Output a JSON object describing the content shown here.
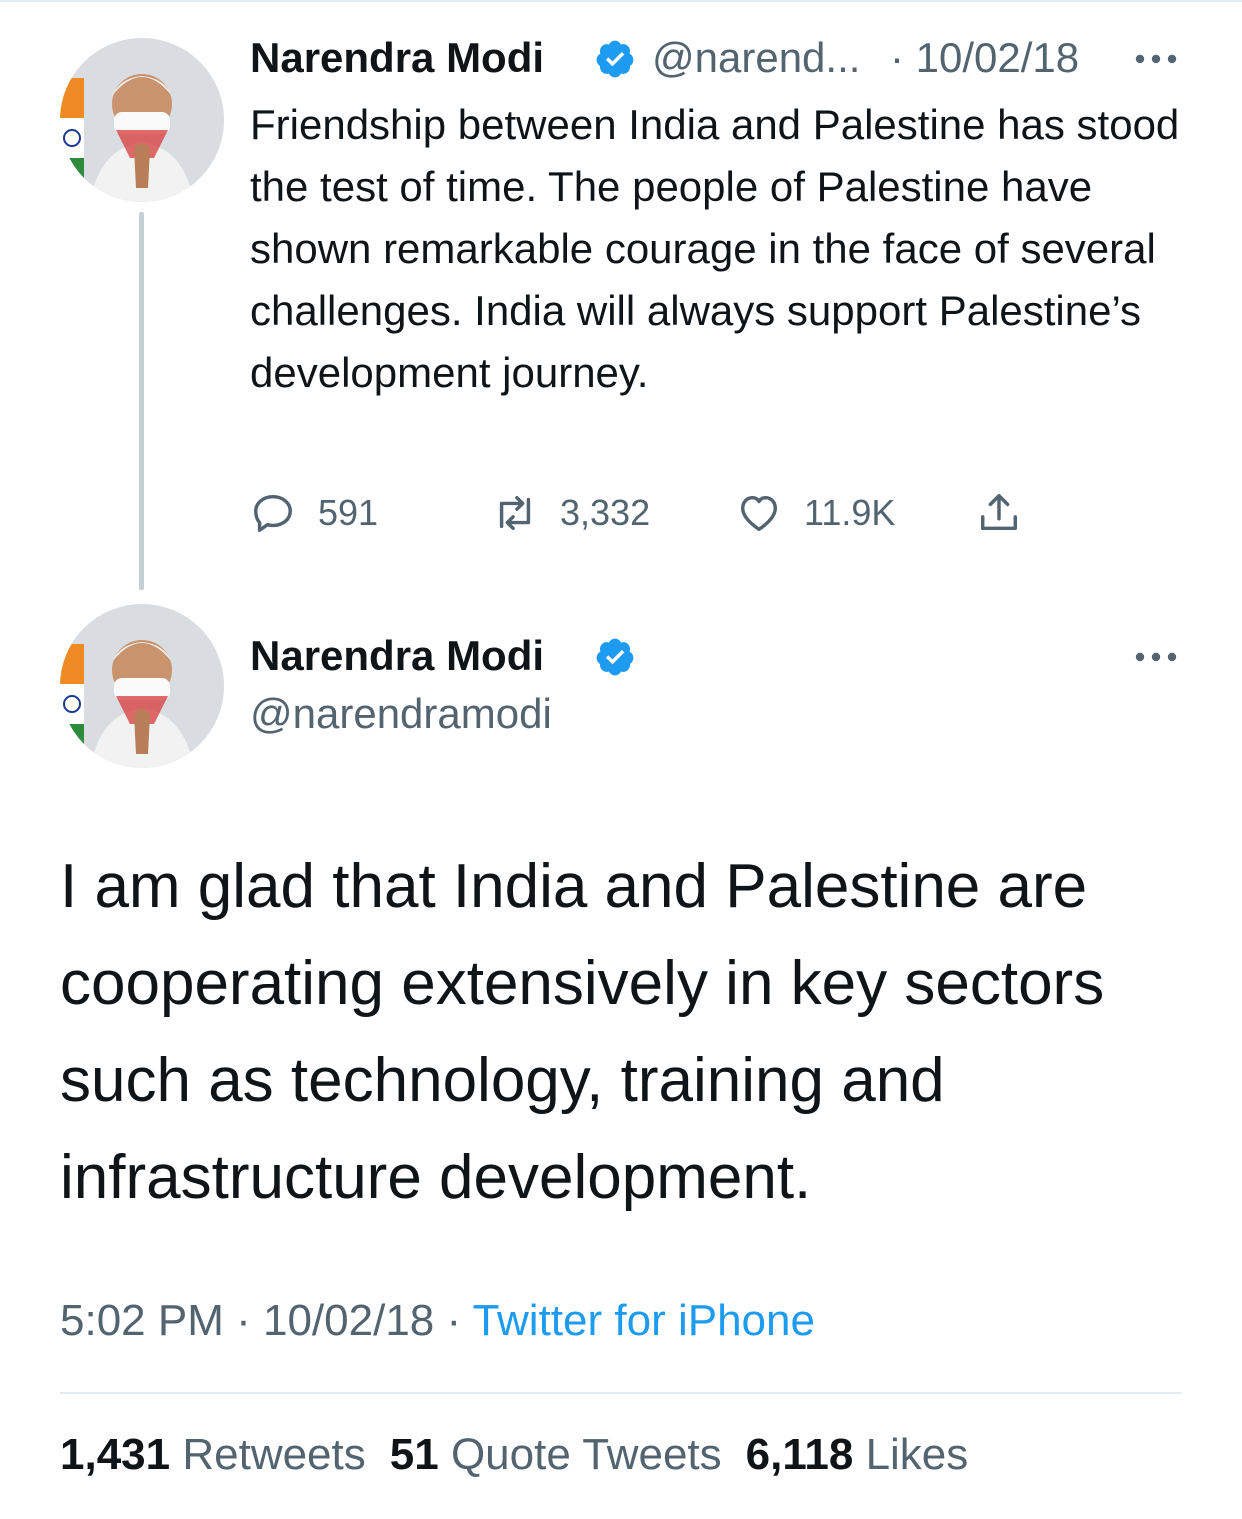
{
  "colors": {
    "text": "#0f1419",
    "secondary": "#536471",
    "link": "#1d9bf0",
    "verified": "#1d9bf0",
    "thread_line": "#c4cfd6"
  },
  "quoted_tweet": {
    "author_name": "Narendra Modi",
    "handle_truncated": "@narend...",
    "date": "· 10/02/18",
    "text": "Friendship between India and Palestine has stood the test of time. The people of Palestine have shown remarkable courage in the face of several challenges. India will always support Palestine’s development journey.",
    "actions": {
      "replies": "591",
      "retweets": "3,332",
      "likes": "11.9K"
    },
    "icons": [
      "reply-icon",
      "retweet-icon",
      "like-icon",
      "share-icon",
      "more-icon",
      "verified-icon"
    ]
  },
  "main_tweet": {
    "author_name": "Narendra Modi",
    "handle": "@narendramodi",
    "text": "I am glad that India and Palestine are cooperating extensively in key sectors such as technology, training and infrastructure development.",
    "time": "5:02 PM",
    "sep1": " · ",
    "date": "10/02/18",
    "sep2": " · ",
    "source": "Twitter for iPhone",
    "stats": {
      "retweets_count": "1,431",
      "retweets_label": "Retweets",
      "quotes_count": "51",
      "quotes_label": "Quote Tweets",
      "likes_count": "6,118",
      "likes_label": "Likes"
    }
  }
}
